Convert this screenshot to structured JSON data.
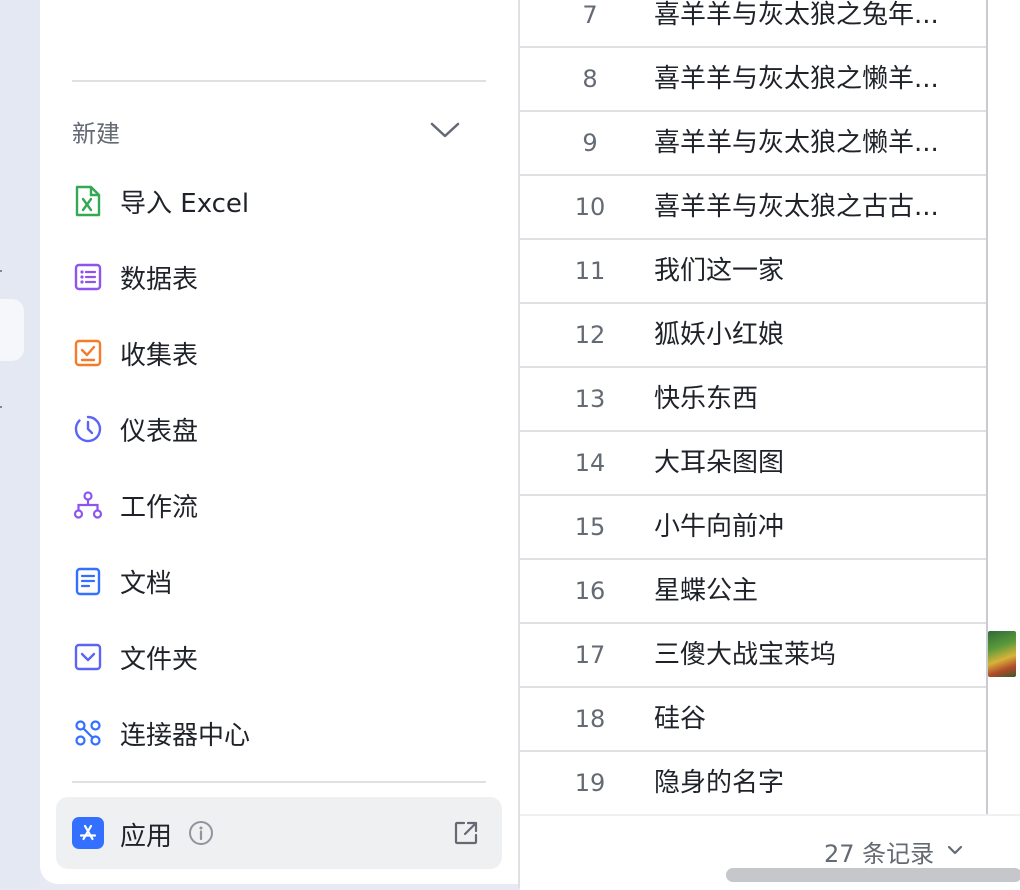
{
  "sidebar": {
    "section_title": "新建",
    "items": [
      {
        "label": "导入 Excel",
        "icon": "excel-icon",
        "color": "#34a853"
      },
      {
        "label": "数据表",
        "icon": "table-icon",
        "color": "#8d55ed"
      },
      {
        "label": "收集表",
        "icon": "form-icon",
        "color": "#f57b28"
      },
      {
        "label": "仪表盘",
        "icon": "dashboard-icon",
        "color": "#5b65f5"
      },
      {
        "label": "工作流",
        "icon": "workflow-icon",
        "color": "#8d55ed"
      },
      {
        "label": "文档",
        "icon": "document-icon",
        "color": "#3370ff"
      },
      {
        "label": "文件夹",
        "icon": "folder-icon",
        "color": "#5b65f5"
      },
      {
        "label": "连接器中心",
        "icon": "connector-icon",
        "color": "#3370ff"
      }
    ],
    "app": {
      "label": "应用",
      "icon": "app-store-icon",
      "color": "#3370ff"
    }
  },
  "table": {
    "rows": [
      {
        "num": "7",
        "name": "喜羊羊与灰太狼之兔年..."
      },
      {
        "num": "8",
        "name": "喜羊羊与灰太狼之懒羊..."
      },
      {
        "num": "9",
        "name": "喜羊羊与灰太狼之懒羊..."
      },
      {
        "num": "10",
        "name": "喜羊羊与灰太狼之古古..."
      },
      {
        "num": "11",
        "name": "我们这一家"
      },
      {
        "num": "12",
        "name": "狐妖小红娘"
      },
      {
        "num": "13",
        "name": "快乐东西"
      },
      {
        "num": "14",
        "name": "大耳朵图图"
      },
      {
        "num": "15",
        "name": "小牛向前冲"
      },
      {
        "num": "16",
        "name": "星蝶公主"
      },
      {
        "num": "17",
        "name": "三傻大战宝莱坞"
      },
      {
        "num": "18",
        "name": "硅谷"
      },
      {
        "num": "19",
        "name": "隐身的名字"
      }
    ],
    "footer": {
      "count_label": "27 条记录"
    }
  }
}
